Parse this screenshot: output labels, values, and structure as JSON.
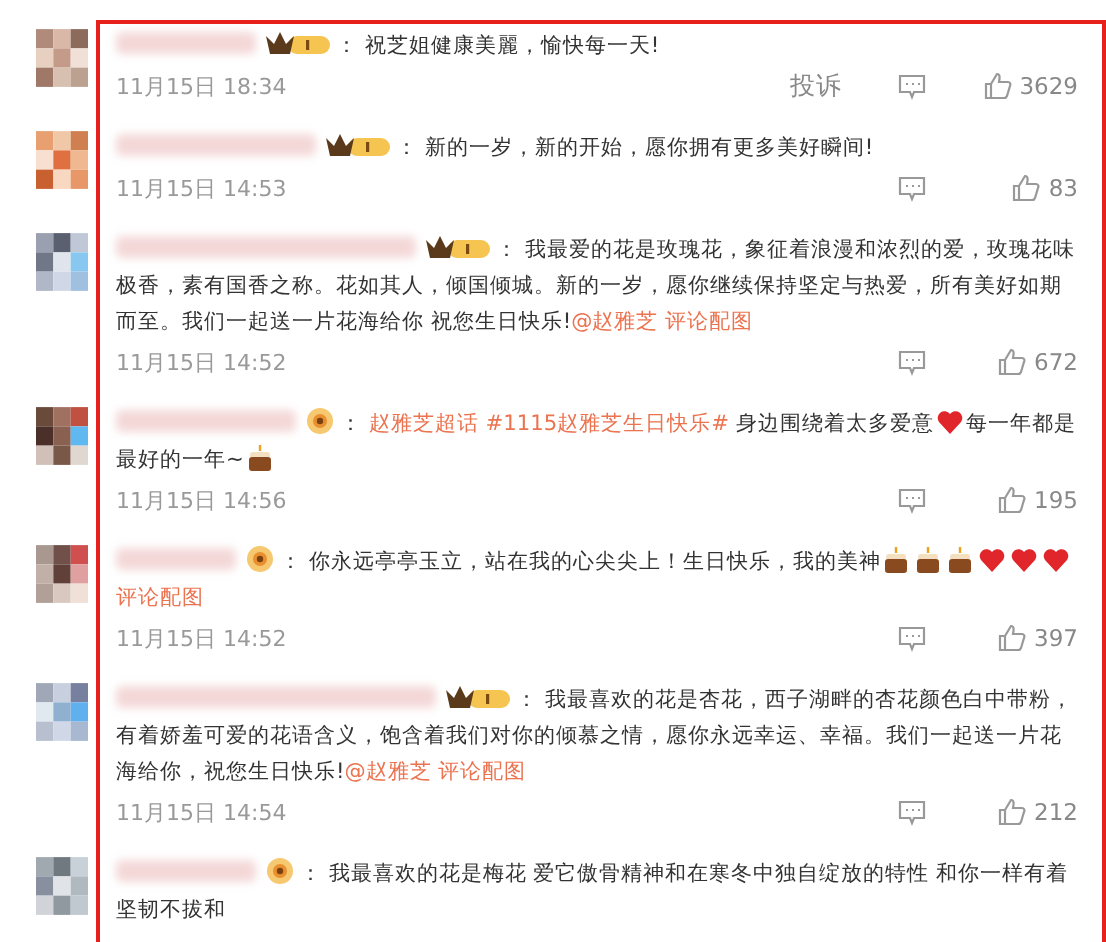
{
  "comments": [
    {
      "badge": {
        "kind": "crown"
      },
      "separator": "：",
      "segments": [
        {
          "kind": "text",
          "text": "祝芝姐健康美麗，愉快每一天!"
        }
      ],
      "date": "11月15日 18:34",
      "report": "投诉",
      "likes": "3629"
    },
    {
      "badge": {
        "kind": "crown"
      },
      "separator": "：",
      "segments": [
        {
          "kind": "text",
          "text": "新的一岁，新的开始，愿你拥有更多美好瞬间!"
        }
      ],
      "date": "11月15日 14:53",
      "likes": "83"
    },
    {
      "badge": {
        "kind": "crown"
      },
      "separator": "：",
      "segments": [
        {
          "kind": "text",
          "text": "我最爱的花是玫瑰花，象征着浪漫和浓烈的爱，玫瑰花味极香，素有国香之称。花如其人，倾国倾城。新的一岁，愿你继续保持坚定与热爱，所有美好如期而至。我们一起送一片花海给你 祝您生日快乐!"
        },
        {
          "kind": "link",
          "text": "@赵雅芝"
        },
        {
          "kind": "link",
          "text": "评论配图"
        }
      ],
      "date": "11月15日 14:52",
      "likes": "672"
    },
    {
      "badge": {
        "kind": "flower"
      },
      "separator": "：",
      "segments": [
        {
          "kind": "link",
          "text": "赵雅芝超话"
        },
        {
          "kind": "link",
          "text": "#1115赵雅芝生日快乐#"
        },
        {
          "kind": "text",
          "text": "身边围绕着太多爱意"
        },
        {
          "kind": "heart"
        },
        {
          "kind": "text",
          "text": "每一年都是最好的一年~"
        },
        {
          "kind": "cake"
        }
      ],
      "date": "11月15日 14:56",
      "likes": "195"
    },
    {
      "badge": {
        "kind": "flower"
      },
      "separator": "：",
      "segments": [
        {
          "kind": "text",
          "text": "你永远亭亭玉立，站在我的心尖尖上！生日快乐，我的美神"
        },
        {
          "kind": "cake"
        },
        {
          "kind": "cake"
        },
        {
          "kind": "cake"
        },
        {
          "kind": "heart"
        },
        {
          "kind": "heart"
        },
        {
          "kind": "heart"
        },
        {
          "kind": "link",
          "text": "评论配图"
        }
      ],
      "date": "11月15日 14:52",
      "likes": "397"
    },
    {
      "badge": {
        "kind": "crown"
      },
      "separator": "：",
      "segments": [
        {
          "kind": "text",
          "text": "我最喜欢的花是杏花，西子湖畔的杏花颜色白中带粉，有着娇羞可爱的花语含义，饱含着我们对你的倾慕之情，愿你永远幸运、幸福。我们一起送一片花海给你，祝您生日快乐!"
        },
        {
          "kind": "link",
          "text": "@赵雅芝"
        },
        {
          "kind": "link",
          "text": "评论配图"
        }
      ],
      "date": "11月15日 14:54",
      "likes": "212"
    },
    {
      "badge": {
        "kind": "flower"
      },
      "separator": "：",
      "segments": [
        {
          "kind": "text",
          "text": "我最喜欢的花是梅花 爱它傲骨精神和在寒冬中独自绽放的特性 和你一样有着坚韧不拔和"
        }
      ]
    }
  ]
}
